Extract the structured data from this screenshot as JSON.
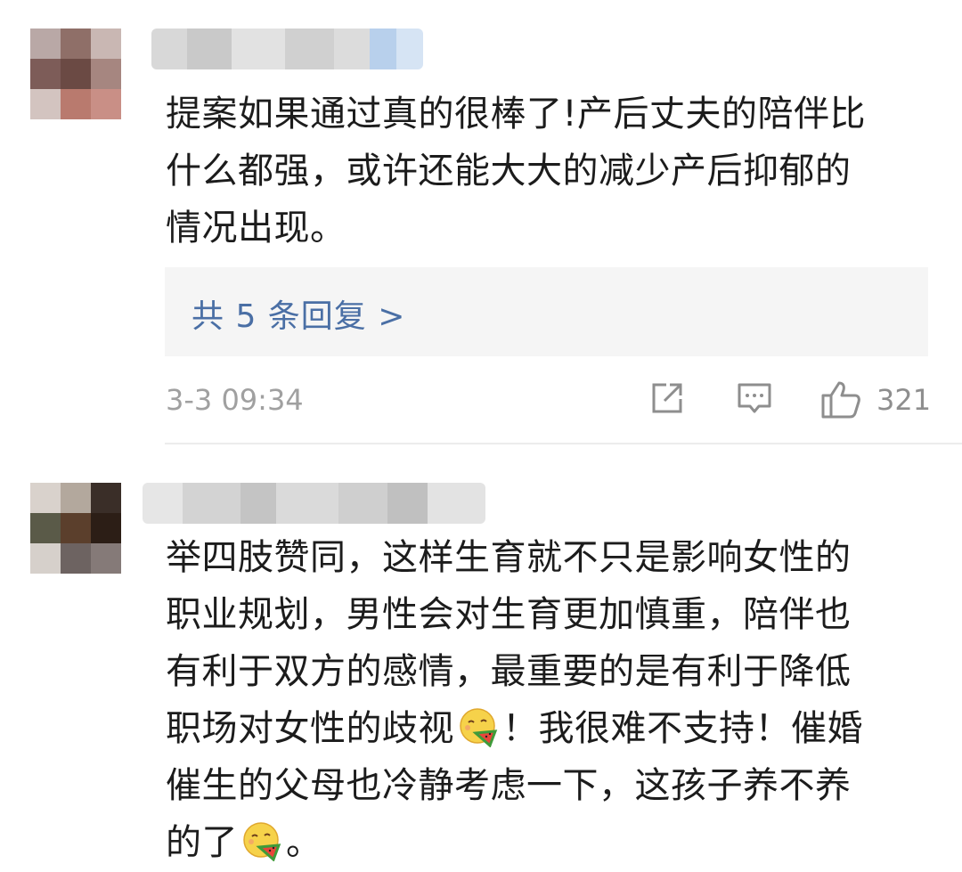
{
  "comments": [
    {
      "text_lines": [
        "提案如果通过真的很棒了!产后丈夫的陪伴比",
        "什么都强，或许还能大大的减少产后抑郁的",
        "情况出现。"
      ],
      "replies_label": "共 5 条回复 >",
      "timestamp": "3-3 09:34",
      "likes": "321",
      "icons": [
        "share-icon",
        "comment-icon",
        "like-icon"
      ]
    },
    {
      "text_segments": {
        "l1": "举四肢赞同，这样生育就不只是影响女性的",
        "l2": "职业规划，男性会对生育更加慎重，陪伴也",
        "l3": "有利于双方的感情，最重要的是有利于降低",
        "l4a": "职场对女性的歧视",
        "l4b": "！我很难不支持！催婚",
        "l5": "催生的父母也冷静考虑一下，这孩子养不养",
        "l6a": "的了",
        "l6b": "。"
      },
      "emoji_name": "eating-watermelon-emoji"
    }
  ],
  "colors": {
    "text": "#1c1c1c",
    "link": "#4a6fa5",
    "meta": "#a0a0a0",
    "reply_bg": "#f5f5f5"
  }
}
